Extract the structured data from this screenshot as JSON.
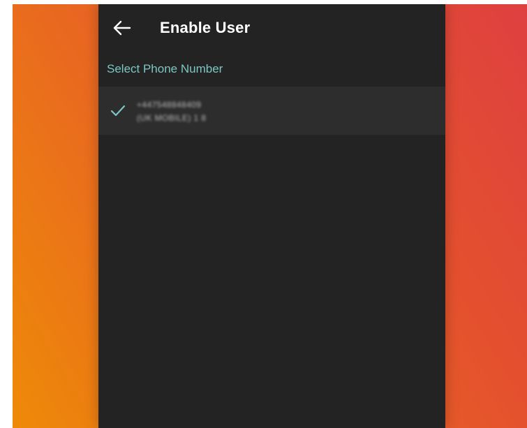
{
  "header": {
    "title": "Enable User",
    "back_icon": "arrow-left-icon"
  },
  "section": {
    "label": "Select Phone Number"
  },
  "phone_list": [
    {
      "number": "+447548848409",
      "detail": "(UK MOBILE) 1 8",
      "selected": true,
      "icon": "check-icon"
    }
  ],
  "colors": {
    "panel_bg": "#232323",
    "row_bg": "#2d2d2d",
    "accent": "#7cc7c3",
    "title": "#ffffff",
    "gradient_start": "#ee8a08",
    "gradient_end": "#de4040"
  }
}
